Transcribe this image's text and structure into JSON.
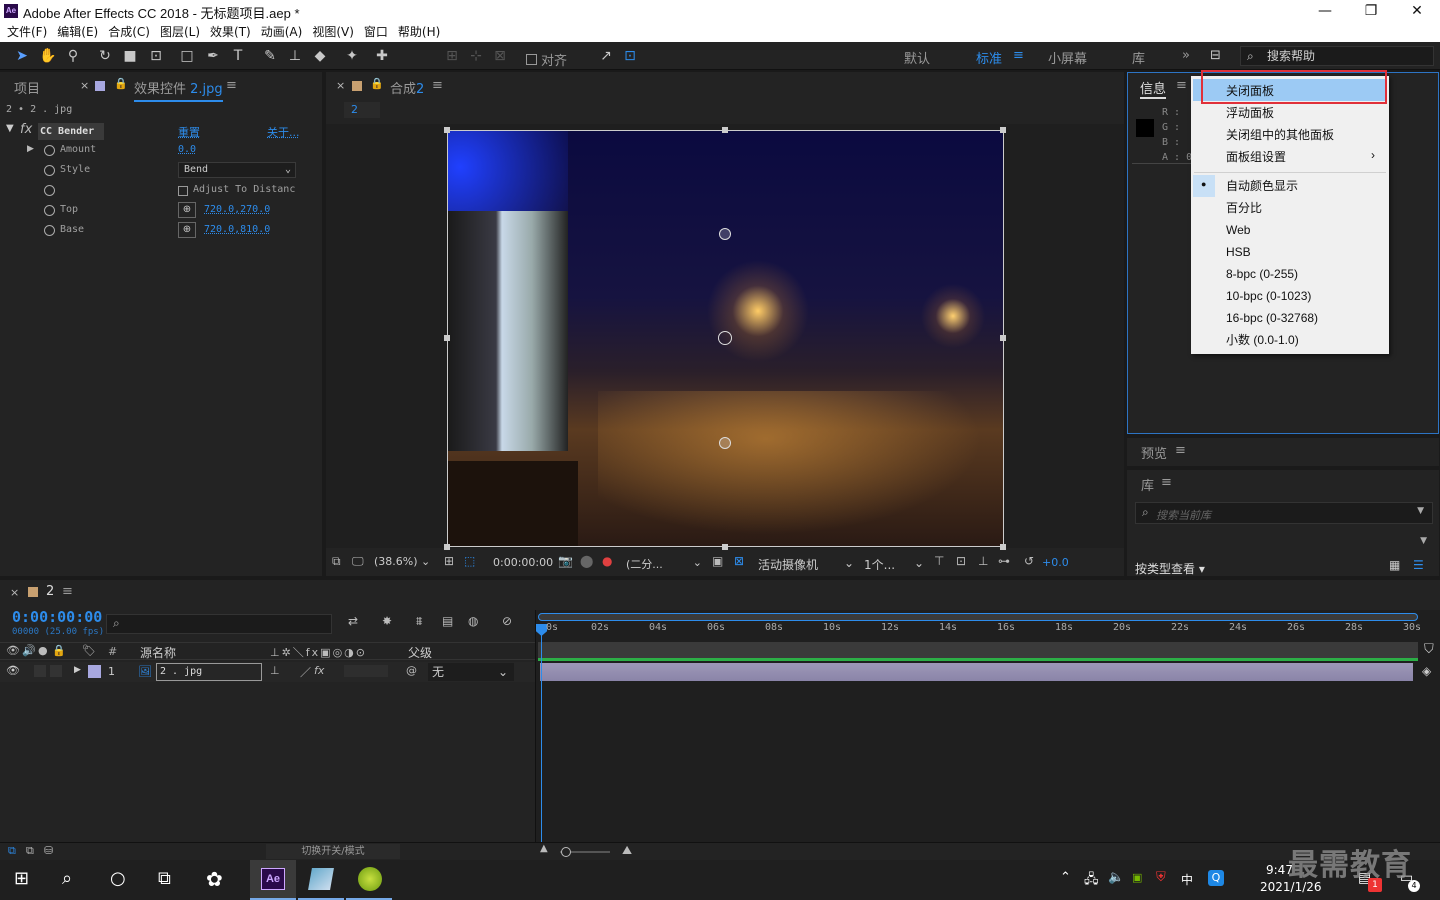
{
  "app": {
    "title": "Adobe After Effects CC 2018 - 无标题项目.aep *",
    "logo": "Ae"
  },
  "menu": [
    "文件(F)",
    "编辑(E)",
    "合成(C)",
    "图层(L)",
    "效果(T)",
    "动画(A)",
    "视图(V)",
    "窗口",
    "帮助(H)"
  ],
  "toolbar": {
    "snap_label": "对齐",
    "workspaces": [
      "默认",
      "标准",
      "小屏幕",
      "库"
    ],
    "active_workspace": "标准",
    "search_placeholder": "搜索帮助"
  },
  "left_panel": {
    "tab_project": "项目",
    "tab_effects_prefix": "效果控件",
    "tab_effects_file": "2.jpg",
    "layer_path": "2 • 2 . jpg",
    "effect_name": "CC Bender",
    "reset_label": "重置",
    "about_label": "关于...",
    "rows": [
      {
        "label": "Amount",
        "value": "0.0"
      },
      {
        "label": "Style",
        "value": "Bend"
      },
      {
        "label": "",
        "value": "Adjust To Distanc"
      },
      {
        "label": "Top",
        "value": "720.0,270.0"
      },
      {
        "label": "Base",
        "value": "720.0,810.0"
      }
    ]
  },
  "comp_panel": {
    "tab_label": "合成",
    "tab_num": "2",
    "breadcrumb": "2",
    "zoom": "(38.6%)",
    "timecode": "0:00:00:00",
    "resolution": "(二分...",
    "camera": "活动摄像机",
    "views": "1个...",
    "exposure": "+0.0"
  },
  "info_panel": {
    "tab": "信息",
    "channels": [
      "R :",
      "G :",
      "B :",
      "A : 0"
    ]
  },
  "dropdown_menu": {
    "items": [
      "关闭面板",
      "浮动面板",
      "关闭组中的其他面板",
      "面板组设置",
      "自动颜色显示",
      "百分比",
      "Web",
      "HSB",
      "8-bpc (0-255)",
      "10-bpc (0-1023)",
      "16-bpc (0-32768)",
      "小数 (0.0-1.0)"
    ],
    "highlighted": "关闭面板",
    "checked": "自动颜色显示",
    "submenu": "面板组设置"
  },
  "preview_panel": {
    "tab": "预览"
  },
  "library_panel": {
    "tab": "库",
    "search_placeholder": "搜索当前库",
    "view_label": "按类型查看"
  },
  "timeline": {
    "tab_num": "2",
    "timecode": "0:00:00:00",
    "fps": "00000 (25.00 fps)",
    "col_hash": "#",
    "col_source": "源名称",
    "col_parent": "父级",
    "ruler": [
      "0s",
      "02s",
      "04s",
      "06s",
      "08s",
      "10s",
      "12s",
      "14s",
      "16s",
      "18s",
      "20s",
      "22s",
      "24s",
      "26s",
      "28s",
      "30s"
    ],
    "layer": {
      "num": "1",
      "name": "2 . jpg",
      "parent": "无"
    },
    "toggle_label": "切换开关/模式"
  },
  "taskbar": {
    "time": "9:47",
    "date": "2021/1/26",
    "ime": "中",
    "notif_badge": "1",
    "action_badge": "4",
    "watermark": "最需教育"
  }
}
